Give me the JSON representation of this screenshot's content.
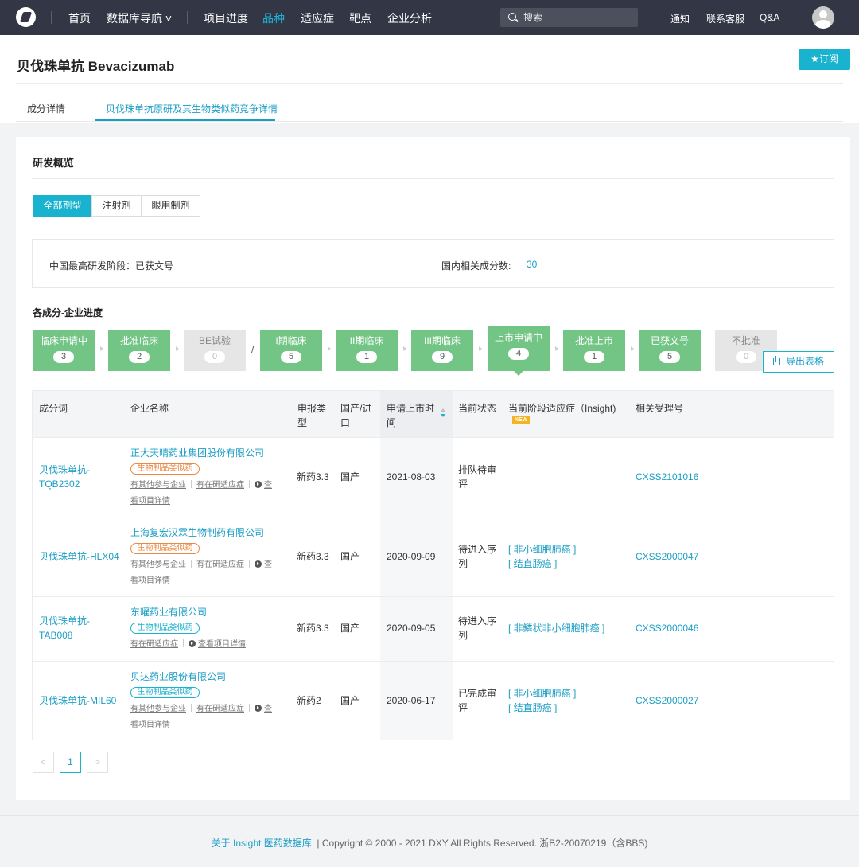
{
  "topbar": {
    "logo": "dxy-logo",
    "nav": [
      {
        "label": "首页",
        "active": false
      },
      {
        "label": "数据库导航 ˅",
        "active": false
      },
      {
        "label": "项目进度",
        "active": false
      },
      {
        "label": "品种",
        "active": true
      },
      {
        "label": "适应症",
        "active": false
      },
      {
        "label": "靶点",
        "active": false
      },
      {
        "label": "企业分析",
        "active": false
      }
    ],
    "search_placeholder": "搜索",
    "links": [
      "通知",
      "联系客服",
      "Q&A"
    ],
    "avatar": "user-avatar-icon"
  },
  "page": {
    "title": "贝伐珠单抗 Bevacizumab",
    "subscribe": "★订阅",
    "tabs": [
      "成分详情",
      "贝伐珠单抗原研及其生物类似药竞争详情"
    ]
  },
  "overview": {
    "title": "研发概览",
    "dosage_tabs": [
      "全部剂型",
      "注射剂",
      "眼用制剂"
    ],
    "summary_stage_label": "中国最高研发阶段：已获文号",
    "summary_count_label": "国内相关成分数:",
    "summary_count_value": "30"
  },
  "progress": {
    "title": "各成分-企业进度",
    "stages": [
      {
        "label": "临床申请中",
        "count": "3"
      },
      {
        "label": "批准临床",
        "count": "2"
      },
      {
        "label": "BE试验",
        "count": "0"
      },
      {
        "label": "I期临床",
        "count": "5"
      },
      {
        "label": "II期临床",
        "count": "1"
      },
      {
        "label": "III期临床",
        "count": "9"
      },
      {
        "label": "上市申请中",
        "count": "4"
      },
      {
        "label": "批准上市",
        "count": "1"
      },
      {
        "label": "已获文号",
        "count": "5"
      },
      {
        "label": "不批准",
        "count": "0"
      }
    ],
    "slash": "/",
    "export_label": "导出表格"
  },
  "table": {
    "headers": [
      "成分词",
      "企业名称",
      "申报类\n型",
      "国产/进\n口",
      "申请上市时\n间",
      "当前状态",
      "当前阶段适应症（Insight)",
      "相关受理号"
    ],
    "new_badge": "NEW",
    "rows": [
      {
        "ingredient": "贝伐珠单抗-\nTQB2302",
        "company": "正大天晴药业集团股份有限公司",
        "tag": "生物制品类似药",
        "links_line1": "有其他参与企业",
        "links_line2": "有在研适应症",
        "links_line3": "查",
        "links_tail": "看项目详情",
        "type": "新药3.3",
        "origin": "国产",
        "date": "2021-08-03",
        "status": "排队待审\n评",
        "indications": "",
        "acceptance": "CXSS2101016"
      },
      {
        "ingredient": "贝伐珠单抗-HLX04",
        "company": "上海复宏汉霖生物制药有限公司",
        "tag": "生物制品类似药",
        "links_line1": "有其他参与企业",
        "links_line2": "有在研适应症",
        "links_line3": "查",
        "links_tail": "看项目详情",
        "type": "新药3.3",
        "origin": "国产",
        "date": "2020-09-09",
        "status": "待进入序\n列",
        "indications": "[ 非小细胞肺癌 ]\n[ 结直肠癌 ]",
        "acceptance": "CXSS2000047"
      },
      {
        "ingredient": "贝伐珠单抗-\nTAB008",
        "company": "东曜药业有限公司",
        "tag": "生物制品类似药",
        "links_line1": "有在研适应症",
        "links_line2": "查看项目详情",
        "type": "新药3.3",
        "origin": "国产",
        "date": "2020-09-05",
        "status": "待进入序\n列",
        "indications": "[ 非鳞状非小细胞肺癌 ]",
        "acceptance": "CXSS2000046"
      },
      {
        "ingredient": "贝伐珠单抗-MIL60",
        "company": "贝达药业股份有限公司",
        "tag": "生物制品类似药",
        "links_line1": "有其他参与企业",
        "links_line2": "有在研适应症",
        "links_line3": "查",
        "links_tail": "看项目详情",
        "type": "新药2",
        "origin": "国产",
        "date": "2020-06-17",
        "status": "已完成审\n评",
        "indications": "[ 非小细胞肺癌 ]\n[ 结直肠癌 ]",
        "acceptance": "CXSS2000027"
      }
    ]
  },
  "pagination": {
    "prev": "<",
    "current": "1",
    "next": ">"
  },
  "footer": {
    "about": "关于 Insight 医药数据库",
    "copyright": "|  Copyright © 2000 - 2021 DXY All Rights Reserved. 浙B2-20070219（含BBS)"
  }
}
